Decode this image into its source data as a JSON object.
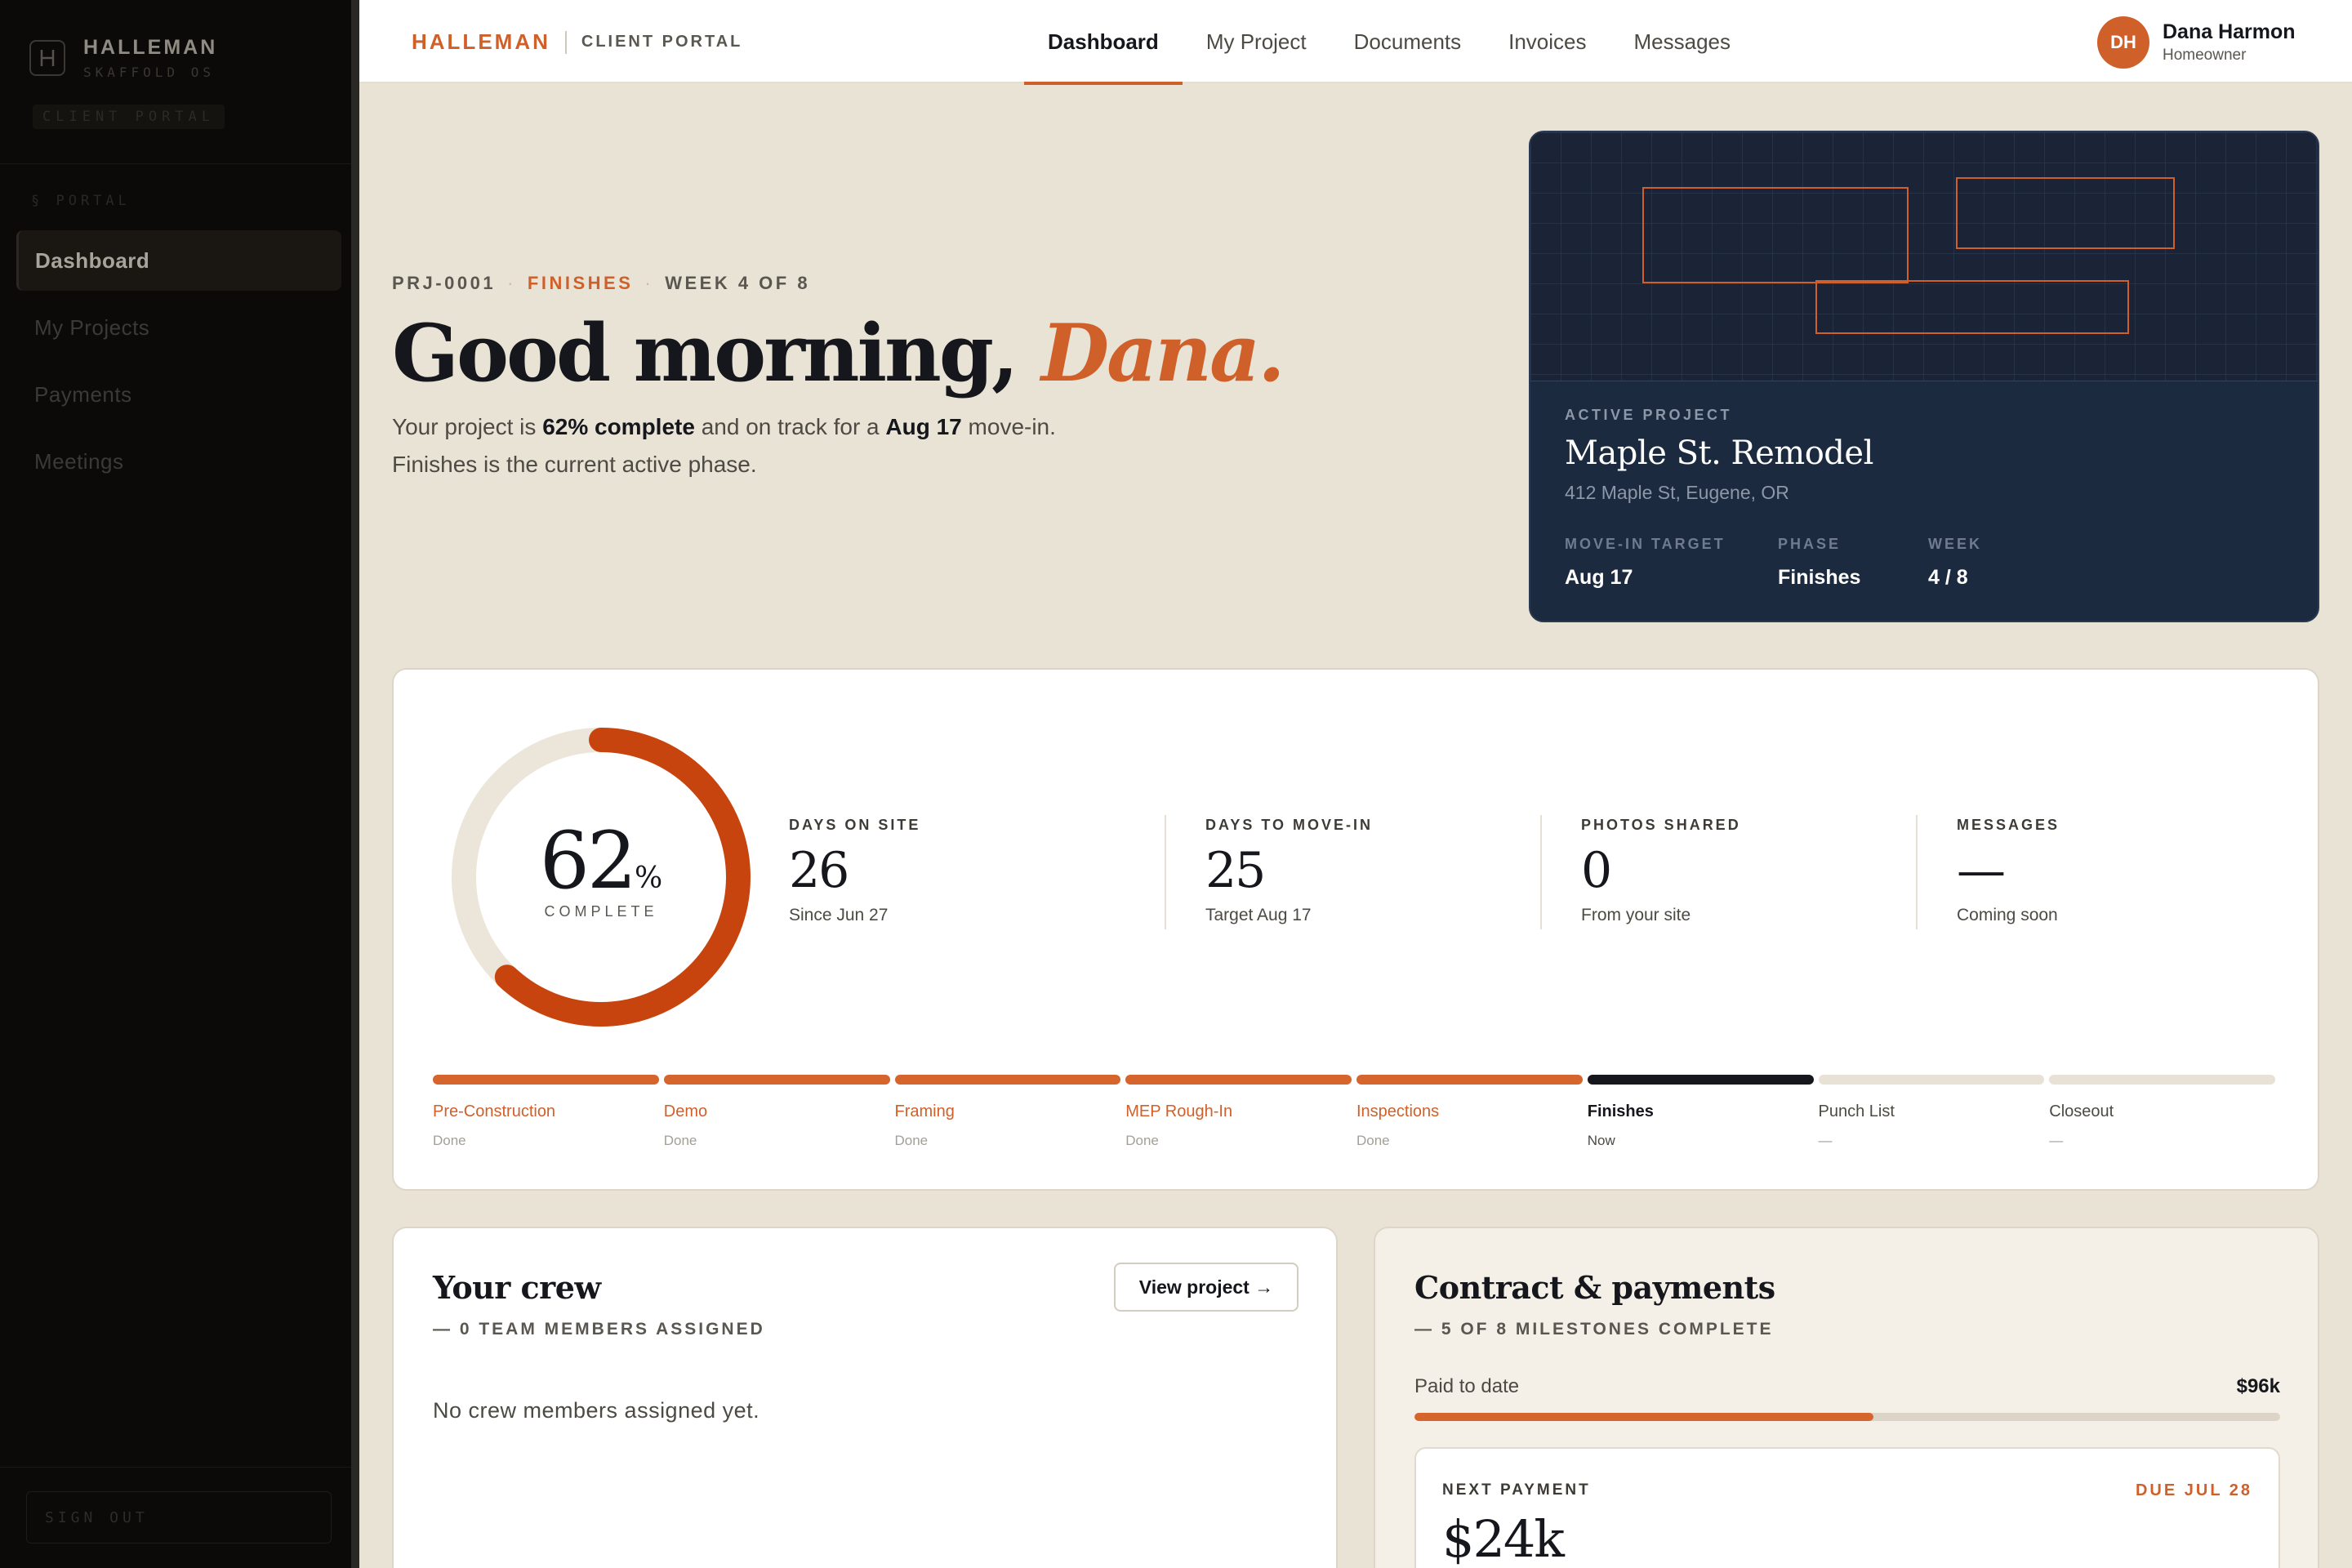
{
  "sidebar": {
    "logo_name": "HALLEMAN",
    "logo_sub": "SKAFFOLD OS",
    "portal_chip": "CLIENT PORTAL",
    "section_label": "§ PORTAL",
    "items": [
      {
        "label": "Dashboard",
        "active": true
      },
      {
        "label": "My Projects",
        "active": false
      },
      {
        "label": "Payments",
        "active": false
      },
      {
        "label": "Meetings",
        "active": false
      }
    ],
    "signout": "SIGN OUT"
  },
  "topbar": {
    "brand": "HALLEMAN",
    "brand_sub": "CLIENT PORTAL",
    "tabs": [
      {
        "label": "Dashboard",
        "active": true
      },
      {
        "label": "My Project",
        "active": false
      },
      {
        "label": "Documents",
        "active": false
      },
      {
        "label": "Invoices",
        "active": false
      },
      {
        "label": "Messages",
        "active": false
      }
    ],
    "user": {
      "initials": "DH",
      "name": "Dana Harmon",
      "role": "Homeowner"
    }
  },
  "hero": {
    "project_id": "PRJ-0001",
    "phase": "FINISHES",
    "week": "WEEK 4 OF 8",
    "greeting": "Good morning,",
    "name": "Dana.",
    "intro_1": "Your project is ",
    "intro_pct": "62% complete",
    "intro_2": " and on track for a ",
    "intro_date": "Aug 17",
    "intro_3": " move-in. Finishes is the current active phase."
  },
  "project_card": {
    "label": "ACTIVE PROJECT",
    "title": "Maple St. Remodel",
    "address": "412 Maple St, Eugene, OR",
    "meta": [
      {
        "label": "MOVE-IN TARGET",
        "value": "Aug 17"
      },
      {
        "label": "PHASE",
        "value": "Finishes"
      },
      {
        "label": "WEEK",
        "value": "4 / 8"
      }
    ]
  },
  "progress": {
    "percent": 62,
    "percent_text": "62",
    "percent_sign": "%",
    "label": "COMPLETE",
    "stats": [
      {
        "label": "DAYS ON SITE",
        "value": "26",
        "sub": "Since Jun 27"
      },
      {
        "label": "DAYS TO MOVE-IN",
        "value": "25",
        "sub": "Target Aug 17"
      },
      {
        "label": "PHOTOS SHARED",
        "value": "0",
        "sub": "From your site"
      },
      {
        "label": "MESSAGES",
        "value": "—",
        "sub": "Coming soon"
      }
    ],
    "phases": [
      {
        "name": "Pre-Construction",
        "status": "Done",
        "state": "done"
      },
      {
        "name": "Demo",
        "status": "Done",
        "state": "done"
      },
      {
        "name": "Framing",
        "status": "Done",
        "state": "done"
      },
      {
        "name": "MEP Rough-In",
        "status": "Done",
        "state": "done"
      },
      {
        "name": "Inspections",
        "status": "Done",
        "state": "done"
      },
      {
        "name": "Finishes",
        "status": "Now",
        "state": "current"
      },
      {
        "name": "Punch List",
        "status": "—",
        "state": "upcoming"
      },
      {
        "name": "Closeout",
        "status": "—",
        "state": "upcoming"
      }
    ]
  },
  "crew": {
    "title": "Your crew",
    "kicker": "— 0 TEAM MEMBERS ASSIGNED",
    "button": "View project →",
    "empty": "No crew members assigned yet."
  },
  "payments": {
    "title": "Contract & payments",
    "kicker": "— 5 OF 8 MILESTONES COMPLETE",
    "paid_label": "Paid to date",
    "paid_value": "$96k",
    "paid_fraction": 0.53,
    "next_label": "NEXT PAYMENT",
    "next_due": "DUE JUL 28",
    "next_amount": "$24k"
  },
  "colors": {
    "accent": "#d0602a",
    "navy": "#1c2a40",
    "ink": "#15171d",
    "background": "#e9e3d6"
  }
}
